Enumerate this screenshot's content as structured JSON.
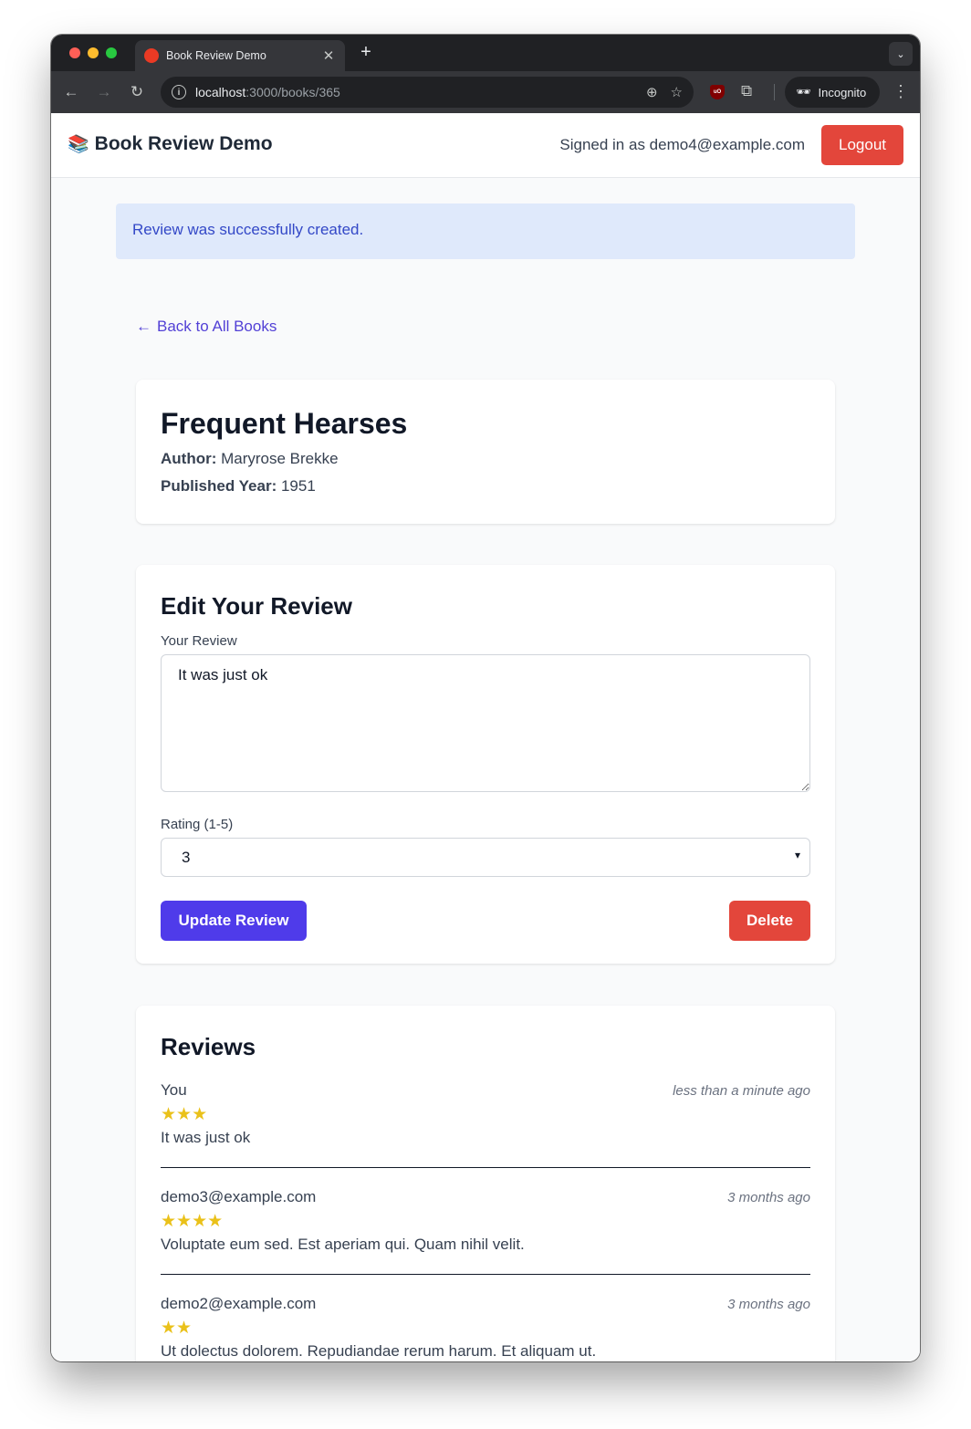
{
  "browser": {
    "tab_title": "Book Review Demo",
    "url_host": "localhost",
    "url_path": ":3000/books/365",
    "incognito_label": "Incognito"
  },
  "navbar": {
    "brand": "Book Review Demo",
    "brand_icon": "books-icon",
    "signed_in": "Signed in as demo4@example.com",
    "logout": "Logout"
  },
  "flash": "Review was successfully created.",
  "back_link": "Back to All Books",
  "book": {
    "title": "Frequent Hearses",
    "author_label": "Author:",
    "author": "Maryrose Brekke",
    "year_label": "Published Year:",
    "year": "1951"
  },
  "edit_form": {
    "title": "Edit Your Review",
    "review_label": "Your Review",
    "review_value": "It was just ok",
    "rating_label": "Rating (1-5)",
    "rating_value": "3",
    "update_button": "Update Review",
    "delete_button": "Delete"
  },
  "reviews": {
    "title": "Reviews",
    "items": [
      {
        "author": "You",
        "time": "less than a minute ago",
        "stars": "★★★",
        "rating": 3,
        "body": "It was just ok"
      },
      {
        "author": "demo3@example.com",
        "time": "3 months ago",
        "stars": "★★★★",
        "rating": 4,
        "body": "Voluptate eum sed. Est aperiam qui. Quam nihil velit."
      },
      {
        "author": "demo2@example.com",
        "time": "3 months ago",
        "stars": "★★",
        "rating": 2,
        "body": "Ut dolectus dolorem. Repudiandae rerum harum. Et aliquam ut."
      }
    ]
  },
  "colors": {
    "primary": "#4f3bea",
    "danger": "#e3463b",
    "star": "#eac11a",
    "flash_bg": "#dfe9fb",
    "flash_text": "#3348c7"
  }
}
